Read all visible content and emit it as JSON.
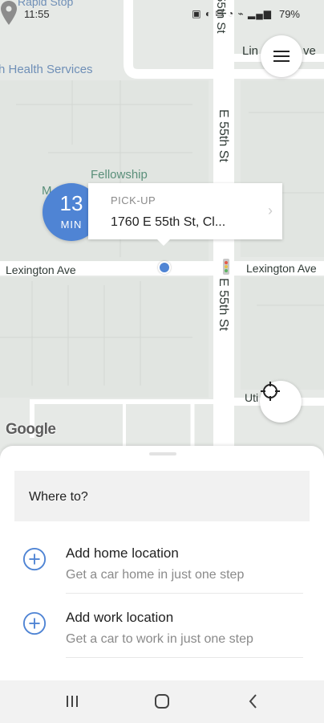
{
  "status": {
    "time": "11:55",
    "battery": "79%"
  },
  "map": {
    "labels": {
      "rapid_stop": "Rapid Stop",
      "health": "h Health Services",
      "fellowship": "Fellowship",
      "m": "M",
      "lexington_left": "Lexington Ave",
      "lexington_right": "Lexington Ave",
      "street_top": "55th St",
      "lin_ave": "Lin",
      "lin_ave_suffix": "ve",
      "e55_upper": "E 55th St",
      "e55_lower": "E 55th St",
      "uti": "Uti",
      "google": "Google"
    }
  },
  "eta": {
    "number": "13",
    "unit": "MIN"
  },
  "pickup": {
    "label": "PICK-UP",
    "address": "1760 E 55th St, Cl..."
  },
  "sheet": {
    "where_to": "Where to?",
    "home": {
      "title": "Add home location",
      "subtitle": "Get a car home in just one step"
    },
    "work": {
      "title": "Add work location",
      "subtitle": "Get a car to work in just one step"
    }
  },
  "icons": {
    "menu": "hamburger-icon",
    "locate": "crosshair-icon",
    "plus": "plus-circle-icon",
    "pin": "map-pin-icon"
  },
  "colors": {
    "accent": "#4f84d4",
    "map_bg": "#e6e9e6",
    "road": "#ffffff"
  }
}
